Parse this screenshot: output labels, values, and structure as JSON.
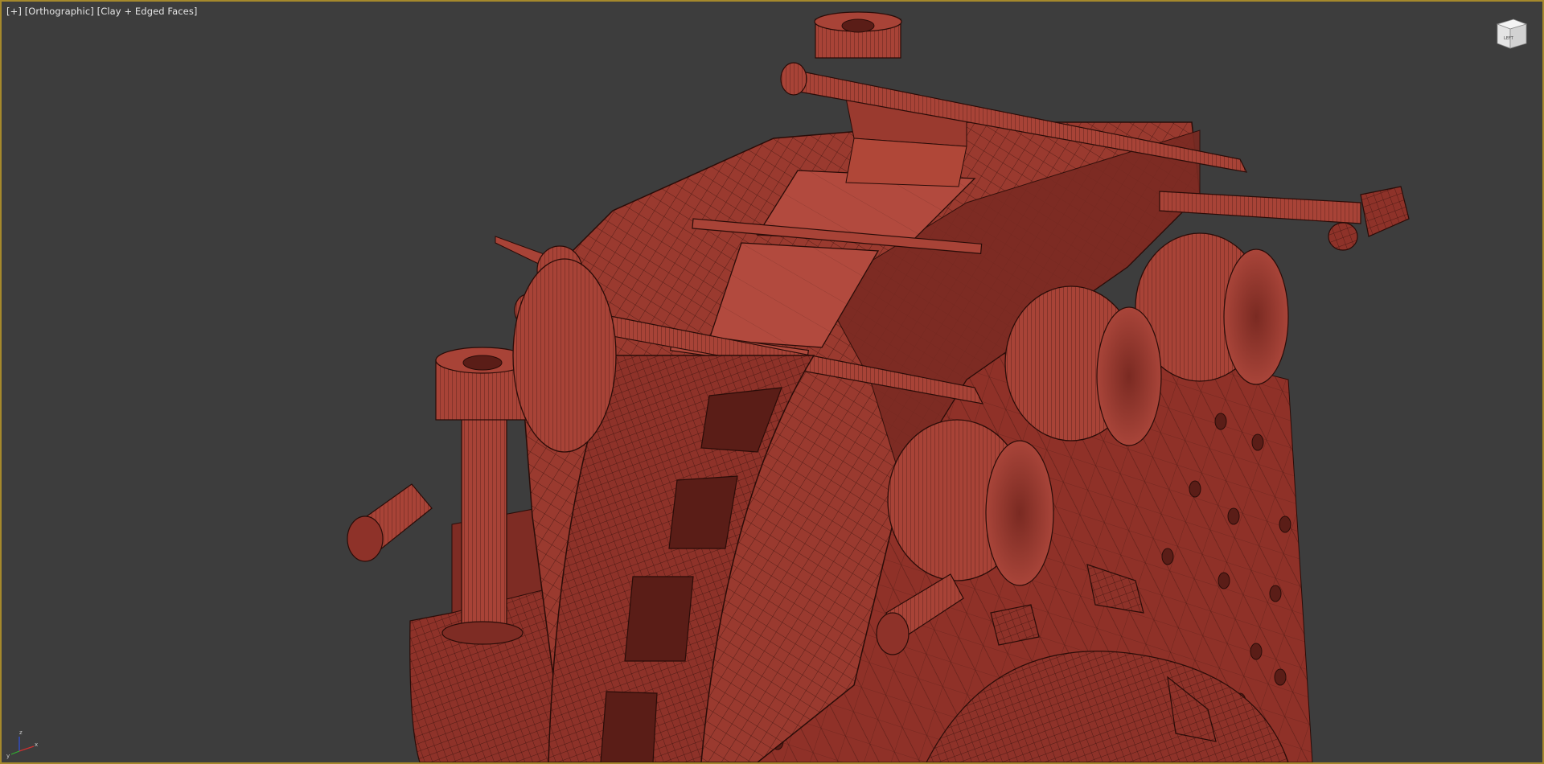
{
  "viewport": {
    "menu_label": "[+]",
    "view_label": "[Orthographic]",
    "shading_label": "[Clay + Edged Faces]"
  },
  "viewcube": {
    "face_label": "LEFT",
    "icon": "viewcube-icon"
  },
  "gizmo": {
    "axis_x": "x",
    "axis_y": "y",
    "axis_z": "z",
    "colors": {
      "x": "#d03030",
      "y": "#30b030",
      "z": "#3050e0"
    }
  },
  "scene": {
    "object": "brake caliper model",
    "material_color": "#9c3a2f",
    "wire_color": "#2a0c08",
    "background_color": "#3d3d3d"
  }
}
